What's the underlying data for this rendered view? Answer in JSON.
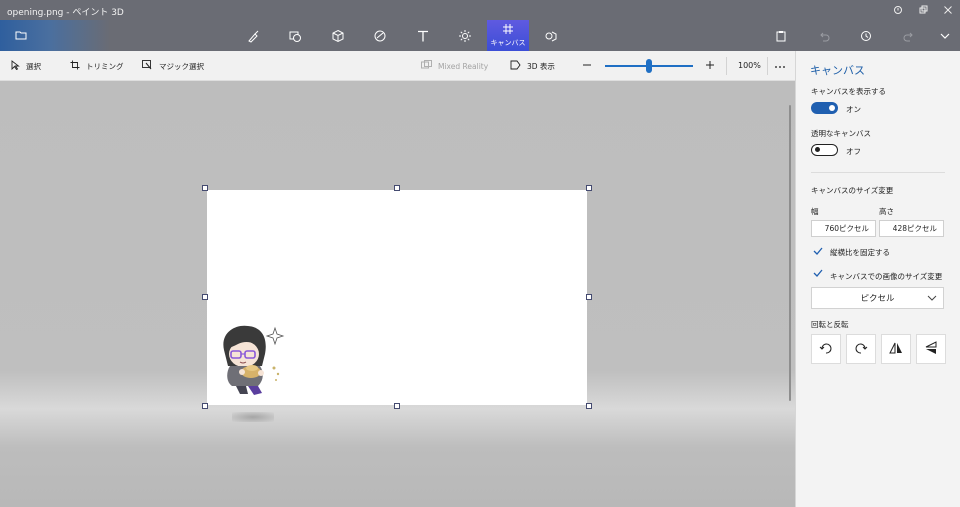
{
  "window": {
    "title": "opening.png - ペイント 3D",
    "controls": [
      "minimize-icon",
      "restore-icon",
      "close-icon"
    ]
  },
  "toolbar": {
    "tools": [
      {
        "name": "brushes",
        "icon": "brush-icon"
      },
      {
        "name": "2d-shapes",
        "icon": "2d-shapes-icon"
      },
      {
        "name": "3d-shapes",
        "icon": "cube-icon"
      },
      {
        "name": "stickers",
        "icon": "sticker-icon"
      },
      {
        "name": "text",
        "icon": "text-icon"
      },
      {
        "name": "effects",
        "icon": "effects-icon"
      },
      {
        "name": "canvas",
        "icon": "canvas-grid-icon",
        "label": "キャンバス",
        "active": true
      },
      {
        "name": "3d-library",
        "icon": "3d-library-icon"
      }
    ],
    "right": [
      "paste-icon",
      "undo-icon",
      "history-icon",
      "redo-icon",
      "expand-menu-icon"
    ]
  },
  "subbar": {
    "select": "選択",
    "trim": "トリミング",
    "magic_select": "マジック選択",
    "mixed_reality": "Mixed Reality",
    "view_3d": "3D 表示",
    "zoom_percent": "100%",
    "zoom_level": 0.47
  },
  "panel": {
    "title": "キャンバス",
    "show_canvas_label": "キャンバスを表示する",
    "show_canvas_state": "オン",
    "transparent_label": "透明なキャンバス",
    "transparent_state": "オフ",
    "resize_label": "キャンバスのサイズ変更",
    "width_label": "幅",
    "height_label": "高さ",
    "width_value": "760ピクセル",
    "height_value": "428ピクセル",
    "lock_aspect": "縦横比を固定する",
    "resize_image": "キャンバスでの画像のサイズ変更",
    "unit": "ピクセル",
    "rotate_flip_label": "回転と反転",
    "rotate_buttons": [
      "rotate-left-icon",
      "rotate-right-icon",
      "flip-horizontal-icon",
      "flip-vertical-icon"
    ]
  },
  "colors": {
    "titlebar": "#6a6c74",
    "active_tool": "#3c4ed6",
    "accent": "#1f5fb0",
    "panel_bg": "#f3f3f3",
    "workspace": "#bdbdbd"
  }
}
